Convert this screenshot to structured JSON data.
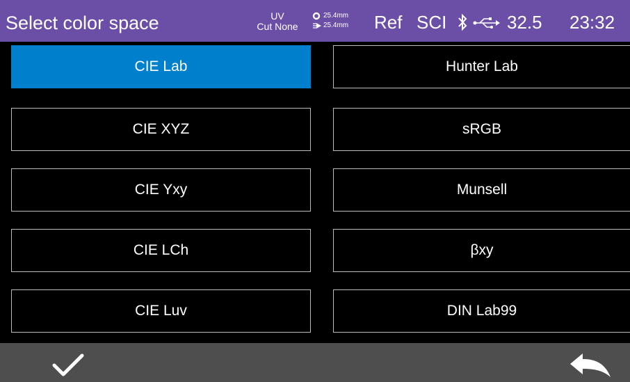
{
  "header": {
    "title": "Select color space",
    "uv_mode": {
      "label": "UV",
      "value": "Cut None"
    },
    "aperture": {
      "measure": "25.4mm",
      "illumination": "25.4mm"
    },
    "ref": "Ref",
    "mode": "SCI",
    "temperature": "32.5",
    "time": "23:32",
    "icons": [
      "bluetooth-icon",
      "usb-icon"
    ]
  },
  "options": {
    "left": [
      "CIE Lab",
      "CIE XYZ",
      "CIE Yxy",
      "CIE LCh",
      "CIE Luv"
    ],
    "right": [
      "Hunter Lab",
      "sRGB",
      "Munsell",
      "βxy",
      "DIN Lab99"
    ],
    "selected": "CIE Lab"
  },
  "footer": {
    "icons": [
      "checkmark-icon",
      "back-arrow-icon"
    ]
  },
  "colors": {
    "header_bg": "#6b4fa6",
    "selected_bg": "#0080cc",
    "footer_bg": "#4e4e4e",
    "background": "#000000"
  }
}
